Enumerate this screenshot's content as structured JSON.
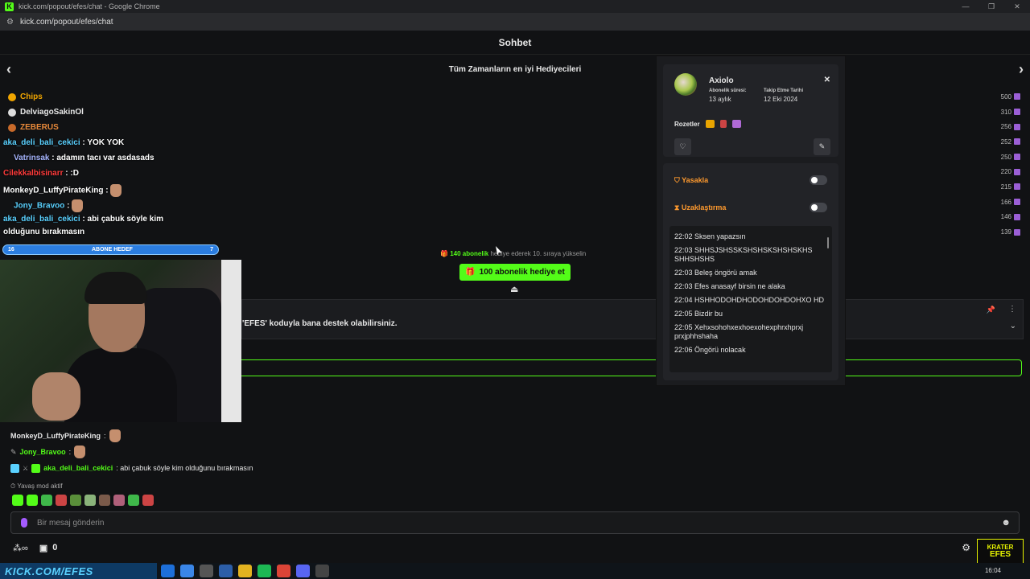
{
  "browser": {
    "window_title": "kick.com/popout/efes/chat - Google Chrome",
    "url": "kick.com/popout/efes/chat"
  },
  "header": {
    "title": "Sohbet"
  },
  "gifters": {
    "title": "Tüm Zamanların en iyi Hediyecileri",
    "rows": [
      {
        "name": "Chips",
        "count": "500"
      },
      {
        "name": "DelviagoSakinOl",
        "count": "310"
      },
      {
        "name": "ZEBERUS",
        "count": "256"
      },
      {
        "name": "",
        "count": "252"
      },
      {
        "name": "",
        "count": "250"
      },
      {
        "name": "",
        "count": "220"
      },
      {
        "name": "",
        "count": "215"
      },
      {
        "name": "",
        "count": "166"
      },
      {
        "name": "",
        "count": "146"
      },
      {
        "name": "",
        "count": "139"
      }
    ]
  },
  "overlay_chat": [
    {
      "user": "aka_deli_bali_cekici",
      "text": ": YOK YOK"
    },
    {
      "user": "Vatrinsak",
      "text": ": adamın tacı var asdasads"
    },
    {
      "user": "Cilekkalbisinarr",
      "text": ": :D"
    },
    {
      "user": "MonkeyD_LuffyPirateKing",
      "text": ":"
    },
    {
      "user": "Jony_Bravoo",
      "text": ":"
    },
    {
      "user": "aka_deli_bali_cekici",
      "text": ": abi çabuk söyle kim"
    },
    {
      "user": "",
      "text": "olduğunu bırakmasın"
    }
  ],
  "goal": {
    "left": "16",
    "label": "ABONE HEDEF",
    "right": "7",
    "progress": 0.98
  },
  "sub_promo": {
    "highlight": "140 abonelik",
    "text": "hediye ederek 10. sıraya yükselin",
    "button": "100 abonelik hediye et"
  },
  "pinned": {
    "text": "'EFES' koduyla bana destek olabilirsiniz."
  },
  "chat": [
    {
      "user": "MonkeyD_LuffyPirateKing",
      "text": ":"
    },
    {
      "user": "Jony_Bravoo",
      "text": ":"
    },
    {
      "user": "aka_deli_bali_cekici",
      "text": ": abi çabuk söyle kim olduğunu bırakmasın"
    }
  ],
  "slow_mode": "Yavaş mod aktif",
  "input": {
    "placeholder": "Bir mesaj gönderin"
  },
  "bottom": {
    "gift_count": "0"
  },
  "logo": {
    "line1": "KRATER",
    "line2": "EFES"
  },
  "taskbar": {
    "kick_url": "KICK.COM/EFES",
    "time": "16:04"
  },
  "user_card": {
    "name": "Axiolo",
    "sub_label": "Abonelik süresi:",
    "sub_value": "13 aylık",
    "follow_label": "Takip Etme Tarihi",
    "follow_value": "12 Eki 2024",
    "badges_label": "Rozetler"
  },
  "mod": {
    "ban_label": "Yasakla",
    "timeout_label": "Uzaklaştırma",
    "history": [
      "22:02 Sksen yapazsın",
      "22:03 SHHSJSHSSKSHSHSKSHSHSKHS SHHSHSHS",
      "22:03 Beleş öngörü amak",
      "22:03 Efes anasayf birsin ne alaka",
      "22:04 HSHHODOHDHODOHDOHDOHXO HD",
      "22:05 Bizdir bu",
      "22:05 Xehxsohohxexhoexohexphrxhprxj prxjphhshaha",
      "22:06 Öngörü nolacak"
    ]
  },
  "colors": {
    "accent": "#53fc18",
    "mod": "#ff9a2e"
  }
}
